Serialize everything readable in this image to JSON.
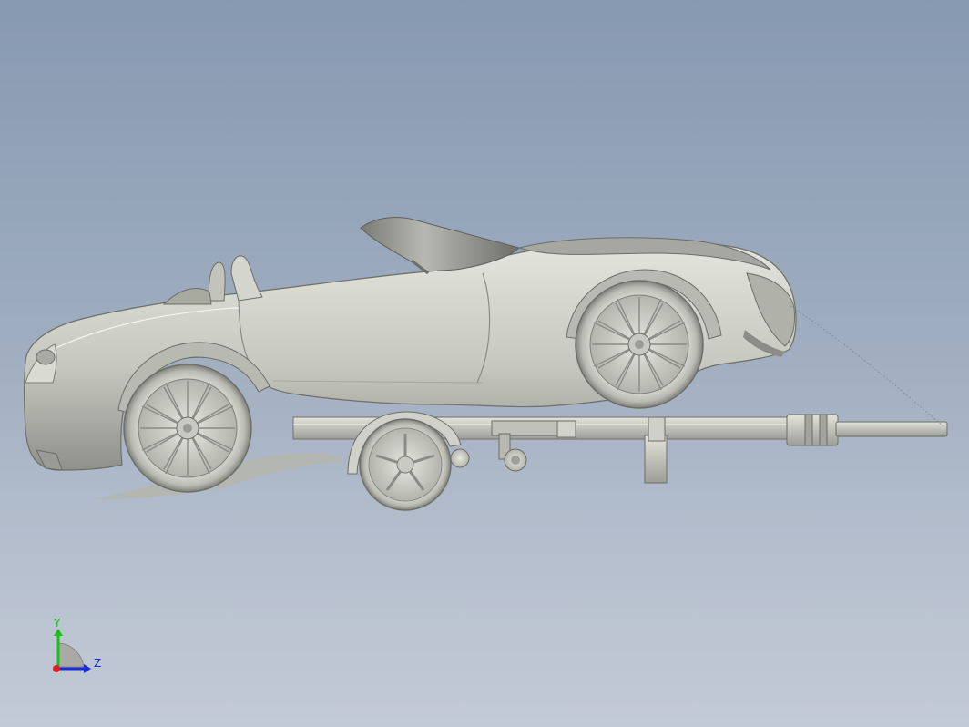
{
  "viewport": {
    "background_top": "#8799b1",
    "background_bottom": "#c3cad6"
  },
  "model": {
    "body_color": "#c8c9c0",
    "body_shade": "#9a9b93",
    "outline_color": "#6e6f68"
  },
  "triad": {
    "y_label": "Y",
    "z_label": "Z",
    "y_color": "#18c018",
    "z_color": "#1a2cd8",
    "origin_color": "#e02020"
  }
}
